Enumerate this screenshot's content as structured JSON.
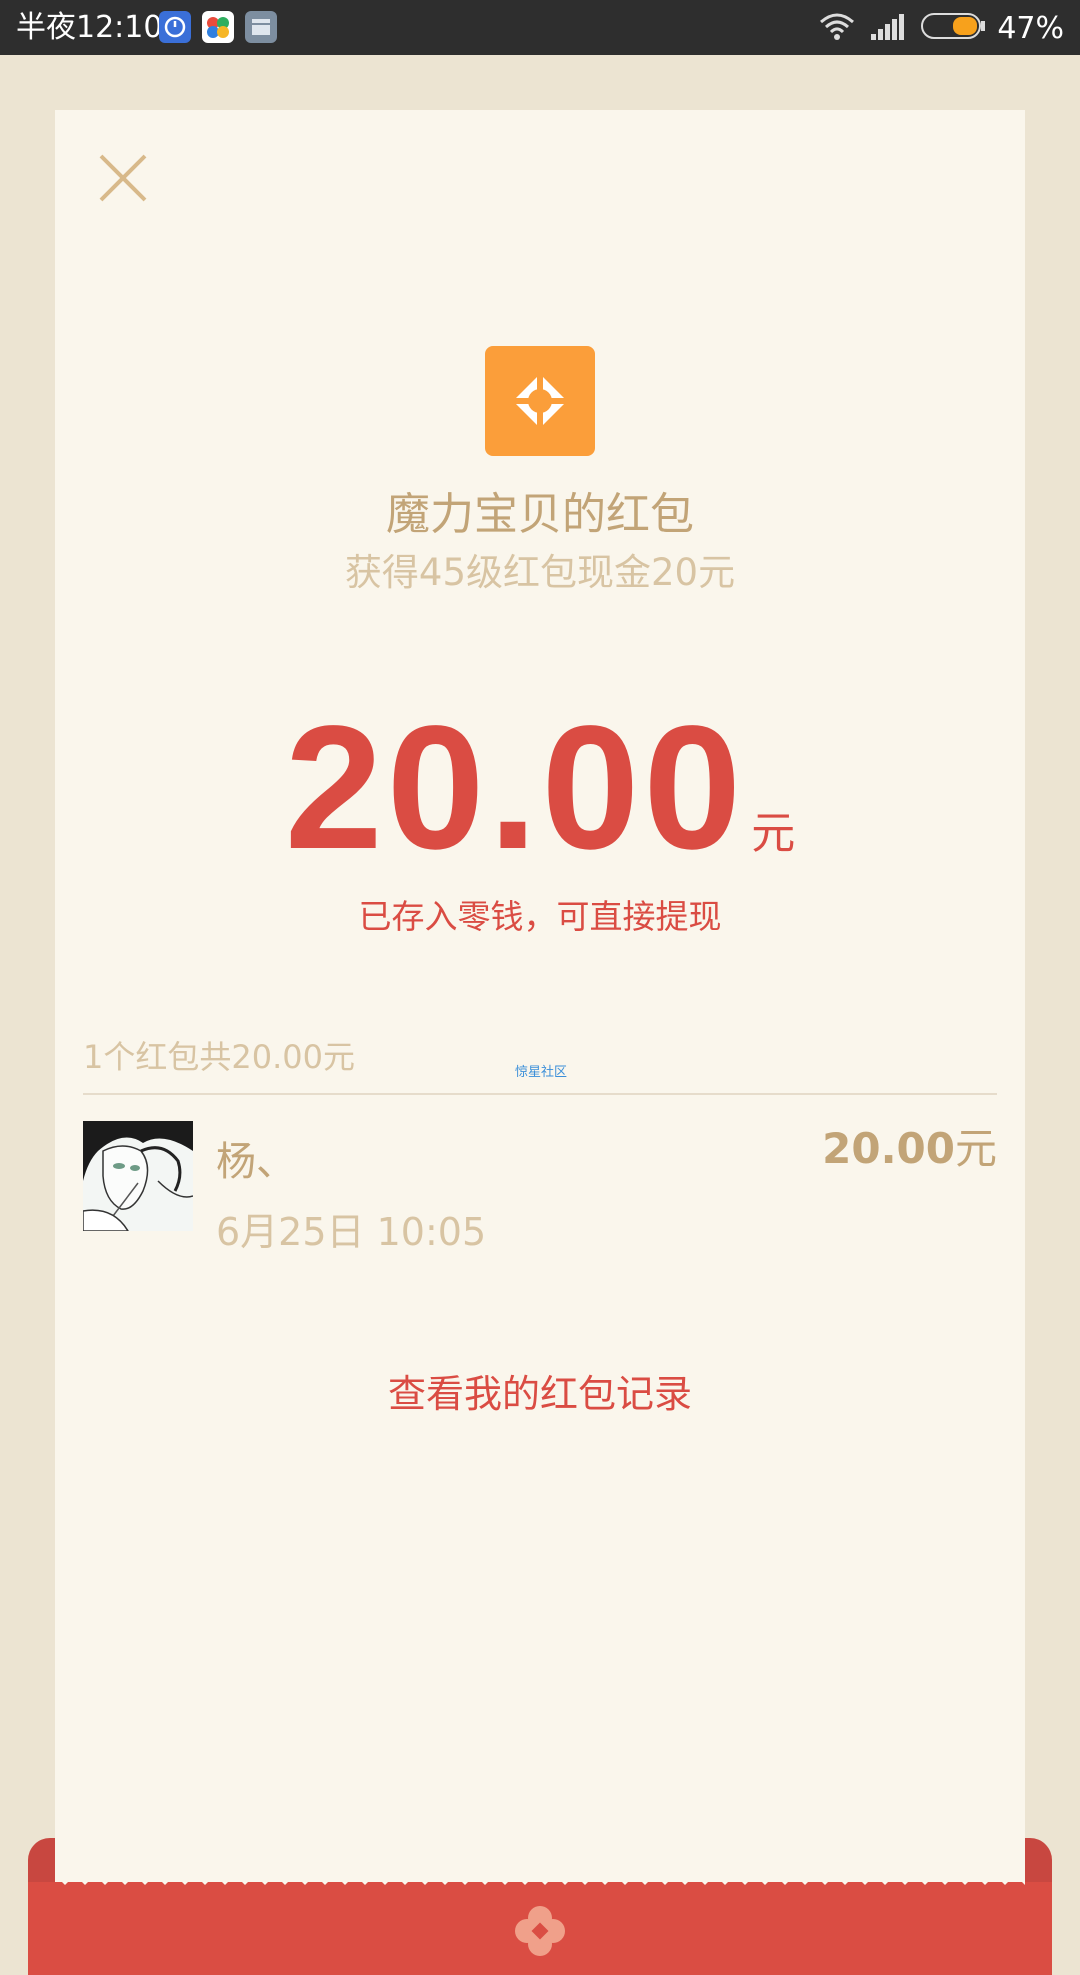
{
  "status_bar": {
    "time": "半夜12:10",
    "battery": "47%",
    "app_icons": [
      "speedometer-icon",
      "colorful-app-icon",
      "notes-app-icon"
    ]
  },
  "packet": {
    "sender_title": "魔力宝贝的红包",
    "greeting": "获得45级红包现金20元",
    "amount": "20.00",
    "amount_unit": "元",
    "deposit_note": "已存入零钱，可直接提现"
  },
  "records": {
    "summary": "1个红包共20.00元",
    "watermark": "惊星社区",
    "items": [
      {
        "name": "杨、",
        "time": "6月25日  10:05",
        "amount": "20.00",
        "unit": "元"
      }
    ]
  },
  "footer": {
    "history_link": "查看我的红包记录"
  },
  "colors": {
    "accent_red": "#da4c43",
    "gold_text": "#c2a477",
    "light_gold_text": "#d8c4a3",
    "card_bg": "#faf6ec",
    "page_bg": "#ece4d2",
    "logo_orange": "#fb9e3a"
  }
}
